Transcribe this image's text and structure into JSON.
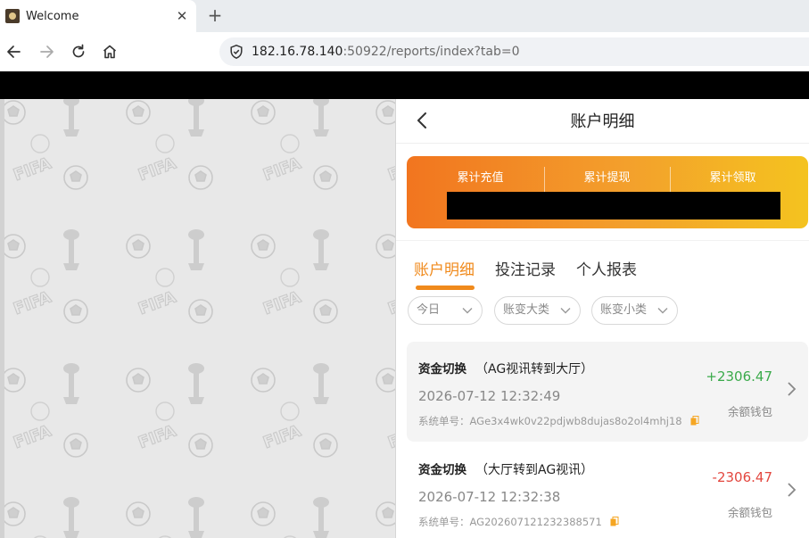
{
  "browser": {
    "tab_title": "Welcome",
    "tab_close": "✕",
    "new_tab": "+",
    "url_host": "182.16.78.140",
    "url_path": ":50922/reports/index?tab=0"
  },
  "header": {
    "title": "账户明细"
  },
  "summary": {
    "labels": [
      "累计充值",
      "累计提现",
      "累计领取"
    ],
    "gradient_colors": [
      "#f2751f",
      "#f4c31f"
    ]
  },
  "tabs": [
    {
      "label": "账户明细",
      "active": true
    },
    {
      "label": "投注记录",
      "active": false
    },
    {
      "label": "个人报表",
      "active": false
    }
  ],
  "filters": [
    {
      "label": "今日"
    },
    {
      "label": "账变大类"
    },
    {
      "label": "账变小类"
    }
  ],
  "records": [
    {
      "type": "资金切换",
      "detail": "（AG视讯转到大厅）",
      "time": "2026-07-12 12:32:49",
      "order_label": "系统单号：",
      "order_no": "AGe3x4wk0v22pdjwb8dujas8o2ol4mhj18",
      "amount": "+2306.47",
      "wallet": "余额钱包"
    },
    {
      "type": "资金切换",
      "detail": "（大厅转到AG视讯）",
      "time": "2026-07-12 12:32:38",
      "order_label": "系统单号：",
      "order_no": "AG202607121232388571",
      "amount": "-2306.47",
      "wallet": "余额钱包"
    }
  ],
  "colors": {
    "accent": "#f08a1c",
    "positive": "#3aaa4a",
    "negative": "#e3473f"
  },
  "pattern": {
    "watermark_text": "FIFA"
  }
}
